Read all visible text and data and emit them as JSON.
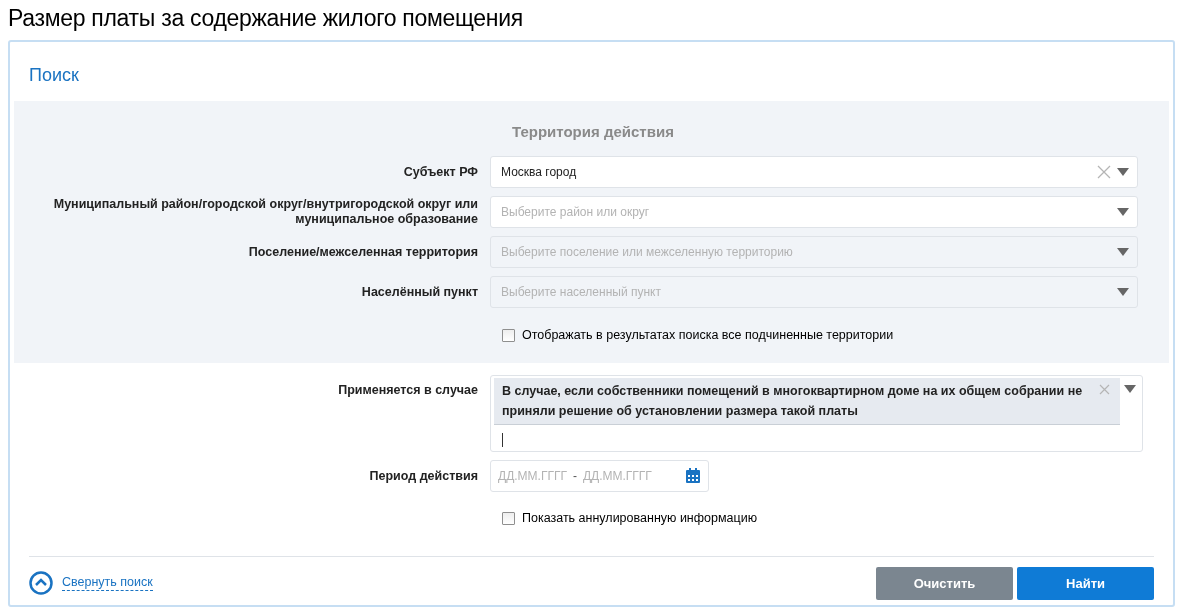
{
  "page_title": "Размер платы за содержание жилого помещения",
  "search_panel": {
    "title": "Поиск",
    "territory": {
      "heading": "Территория действия",
      "fields": [
        {
          "label": "Субъект РФ",
          "value": "Москва город",
          "disabled": false,
          "clearable": true
        },
        {
          "label": "Муниципальный район/городской округ/внутригородской округ или муниципальное образование",
          "placeholder": "Выберите район или округ",
          "disabled": false,
          "clearable": false
        },
        {
          "label": "Поселение/межселенная территория",
          "placeholder": "Выберите поселение или межселенную территорию",
          "disabled": true,
          "clearable": false
        },
        {
          "label": "Населённый пункт",
          "placeholder": "Выберите населенный пункт",
          "disabled": true,
          "clearable": false
        }
      ],
      "checkbox": {
        "label": "Отображать в результатах поиска все подчиненные территории",
        "checked": false
      }
    },
    "applies_when": {
      "label": "Применяется в случае",
      "tags": [
        "В случае, если собственники помещений в многоквартирном доме на их общем собрании не приняли решение об установлении размера такой платы"
      ]
    },
    "period": {
      "label": "Период действия",
      "from_placeholder": "ДД.ММ.ГГГГ",
      "separator": "-",
      "to_placeholder": "ДД.ММ.ГГГГ"
    },
    "annulled_checkbox": {
      "label": "Показать аннулированную информацию",
      "checked": false
    },
    "collapse_link": "Свернуть поиск",
    "buttons": [
      {
        "label": "Очистить",
        "kind": "secondary"
      },
      {
        "label": "Найти",
        "kind": "primary"
      }
    ]
  }
}
